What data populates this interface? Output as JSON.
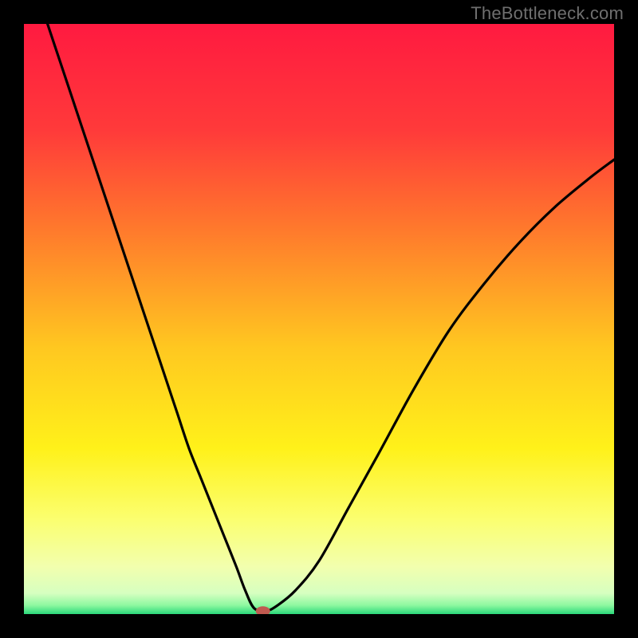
{
  "watermark": {
    "text": "TheBottleneck.com"
  },
  "chart_data": {
    "type": "line",
    "title": "",
    "xlabel": "",
    "ylabel": "",
    "xlim": [
      0,
      100
    ],
    "ylim": [
      0,
      100
    ],
    "grid": false,
    "legend": false,
    "background": {
      "type": "vertical-gradient",
      "stops": [
        {
          "pos": 0.0,
          "color": "#ff1a40"
        },
        {
          "pos": 0.18,
          "color": "#ff3a3a"
        },
        {
          "pos": 0.35,
          "color": "#ff7a2c"
        },
        {
          "pos": 0.55,
          "color": "#ffc820"
        },
        {
          "pos": 0.72,
          "color": "#fff11a"
        },
        {
          "pos": 0.84,
          "color": "#fbff70"
        },
        {
          "pos": 0.92,
          "color": "#f2ffae"
        },
        {
          "pos": 0.965,
          "color": "#d6ffc0"
        },
        {
          "pos": 0.985,
          "color": "#8ef8a0"
        },
        {
          "pos": 1.0,
          "color": "#2bd87a"
        }
      ]
    },
    "series": [
      {
        "name": "bottleneck-curve",
        "color": "#000000",
        "x": [
          4,
          6,
          8,
          10,
          12,
          14,
          16,
          18,
          20,
          22,
          24,
          26,
          28,
          30,
          32,
          34,
          36,
          37.5,
          39,
          41,
          43,
          46,
          50,
          55,
          60,
          66,
          72,
          78,
          84,
          90,
          96,
          100
        ],
        "y": [
          100,
          94,
          88,
          82,
          76,
          70,
          64,
          58,
          52,
          46,
          40,
          34,
          28,
          23,
          18,
          13,
          8,
          4,
          1,
          0.5,
          1.5,
          4,
          9,
          18,
          27,
          38,
          48,
          56,
          63,
          69,
          74,
          77
        ]
      }
    ],
    "marker": {
      "name": "optimal-point",
      "x": 40.5,
      "y": 0.5,
      "color": "#c05a50",
      "rx": 9,
      "ry": 6
    }
  }
}
